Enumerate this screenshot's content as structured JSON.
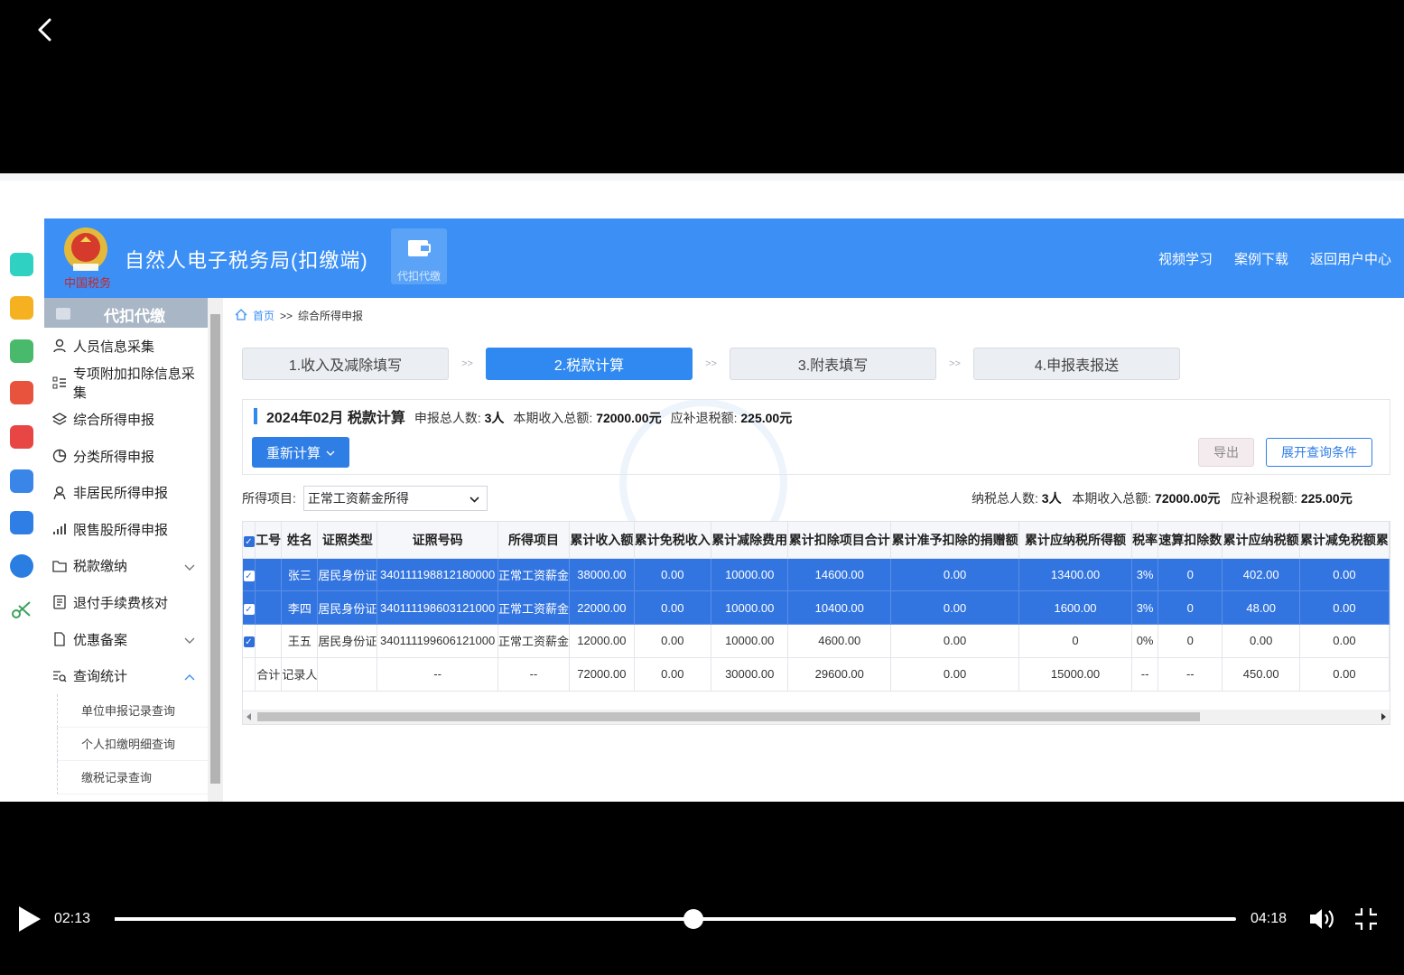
{
  "app": {
    "title": "自然人电子税务局(扣缴端)",
    "emblem_text": "中国税务",
    "module_label": "代扣代缴",
    "header_links": [
      "视频学习",
      "案例下载",
      "返回用户中心"
    ]
  },
  "sidebar": {
    "header": "代扣代缴",
    "items": [
      {
        "label": "人员信息采集",
        "icon": "person-icon"
      },
      {
        "label": "专项附加扣除信息采集",
        "icon": "list-icon"
      },
      {
        "label": "综合所得申报",
        "icon": "layers-icon"
      },
      {
        "label": "分类所得申报",
        "icon": "pie-icon"
      },
      {
        "label": "非居民所得申报",
        "icon": "user-outline-icon"
      },
      {
        "label": "限售股所得申报",
        "icon": "signal-icon"
      },
      {
        "label": "税款缴纳",
        "icon": "folder-icon"
      },
      {
        "label": "退付手续费核对",
        "icon": "ledger-icon"
      },
      {
        "label": "优惠备案",
        "icon": "doc-icon"
      },
      {
        "label": "查询统计",
        "icon": "query-icon"
      }
    ],
    "sub_items": [
      "单位申报记录查询",
      "个人扣缴明细查询",
      "缴税记录查询"
    ]
  },
  "breadcrumb": {
    "home": "首页",
    "sep": ">>",
    "current": "综合所得申报"
  },
  "steps": [
    {
      "label": "1.收入及减除填写",
      "active": false
    },
    {
      "label": "2.税款计算",
      "active": true
    },
    {
      "label": "3.附表填写",
      "active": false
    },
    {
      "label": "4.申报表报送",
      "active": false
    }
  ],
  "step_separator": ">>",
  "calc": {
    "title": "2024年02月  税款计算",
    "headcount_label": "申报总人数:",
    "headcount": "3人",
    "income_label": "本期收入总额:",
    "income": "72000.00元",
    "tax_label": "应补退税额:",
    "tax": "225.00元",
    "recalc_label": "重新计算",
    "export_label": "导出",
    "expand_label": "展开查询条件"
  },
  "filter": {
    "label": "所得项目:",
    "value": "正常工资薪金所得",
    "totals": {
      "headcount_label": "纳税总人数:",
      "headcount": "3人",
      "income_label": "本期收入总额:",
      "income": "72000.00元",
      "tax_label": "应补退税额:",
      "tax": "225.00元"
    }
  },
  "table": {
    "columns": [
      "工号",
      "姓名",
      "证照类型",
      "证照号码",
      "所得项目",
      "累计收入额",
      "累计免税收入",
      "累计减除费用",
      "累计扣除项目合计",
      "累计准予扣除的捐赠额",
      "累计应纳税所得额",
      "税率",
      "速算扣除数",
      "累计应纳税额",
      "累计减免税额累"
    ],
    "rows": [
      {
        "selected": true,
        "cells": [
          "",
          "张三",
          "居民身份证",
          "340111198812180000",
          "正常工资薪金",
          "38000.00",
          "0.00",
          "10000.00",
          "14600.00",
          "0.00",
          "13400.00",
          "3%",
          "0",
          "402.00",
          "0.00"
        ]
      },
      {
        "selected": true,
        "cells": [
          "",
          "李四",
          "居民身份证",
          "340111198603121000",
          "正常工资薪金",
          "22000.00",
          "0.00",
          "10000.00",
          "10400.00",
          "0.00",
          "1600.00",
          "3%",
          "0",
          "48.00",
          "0.00"
        ]
      },
      {
        "selected": false,
        "checked": true,
        "cells": [
          "",
          "王五",
          "居民身份证",
          "340111199606121000",
          "正常工资薪金",
          "12000.00",
          "0.00",
          "10000.00",
          "4600.00",
          "0.00",
          "0",
          "0%",
          "0",
          "0.00",
          "0.00"
        ]
      }
    ],
    "total_row": [
      "合计",
      "记录人",
      "",
      "--",
      "--",
      "72000.00",
      "0.00",
      "30000.00",
      "29600.00",
      "0.00",
      "15000.00",
      "--",
      "--",
      "450.00",
      "0.00"
    ]
  },
  "player": {
    "elapsed": "02:13",
    "duration": "04:18",
    "progress": 0.516
  }
}
